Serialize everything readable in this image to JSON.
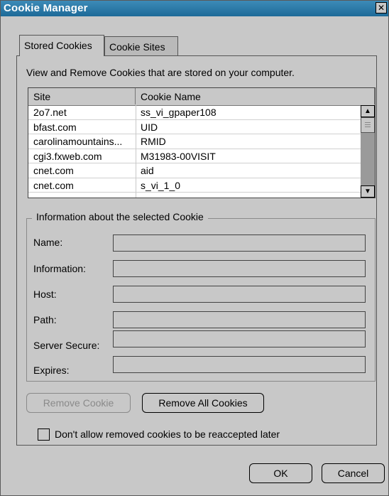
{
  "window": {
    "title": "Cookie Manager",
    "close_label": "✕"
  },
  "tabs": [
    {
      "label": "Stored Cookies",
      "active": true
    },
    {
      "label": "Cookie Sites",
      "active": false
    }
  ],
  "description": "View and Remove Cookies that are stored on your computer.",
  "table": {
    "columns": [
      "Site",
      "Cookie Name"
    ],
    "rows": [
      {
        "site": "2o7.net",
        "name": "ss_vi_gpaper108"
      },
      {
        "site": "bfast.com",
        "name": "UID"
      },
      {
        "site": "carolinamountains...",
        "name": "RMID"
      },
      {
        "site": "cgi3.fxweb.com",
        "name": "M31983-00VISIT"
      },
      {
        "site": "cnet.com",
        "name": "aid"
      },
      {
        "site": "cnet.com",
        "name": "s_vi_1_0"
      }
    ]
  },
  "info": {
    "group_title": "Information about the selected Cookie",
    "fields": [
      {
        "label": "Name:",
        "value": ""
      },
      {
        "label": "Information:",
        "value": ""
      },
      {
        "label": "Host:",
        "value": ""
      },
      {
        "label": "Path:",
        "value": ""
      },
      {
        "label": "Server Secure:",
        "value": ""
      },
      {
        "label": "Expires:",
        "value": ""
      }
    ]
  },
  "buttons": {
    "remove_cookie": "Remove Cookie",
    "remove_all": "Remove All Cookies",
    "ok": "OK",
    "cancel": "Cancel"
  },
  "checkbox": {
    "label": "Don't allow removed cookies to be reaccepted later",
    "checked": false
  },
  "colors": {
    "titlebar": "#2a78a8",
    "background": "#c8c8c8"
  }
}
